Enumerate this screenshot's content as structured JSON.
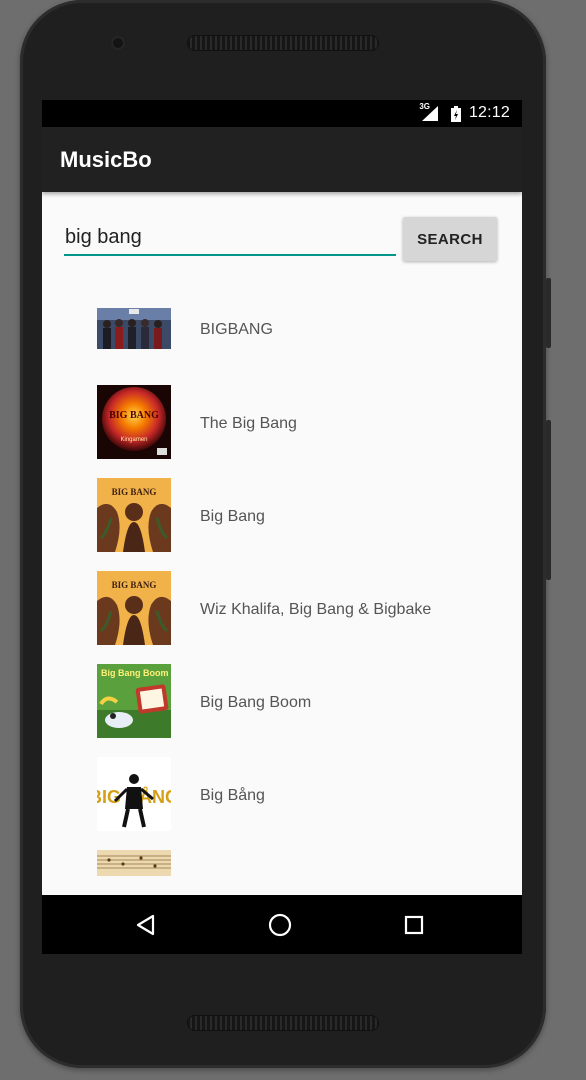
{
  "status_bar": {
    "network": "3G",
    "time": "12:12"
  },
  "app": {
    "title": "MusicBo"
  },
  "search": {
    "value": "big bang",
    "button_label": "SEARCH"
  },
  "results": [
    {
      "title": "BIGBANG",
      "thumbnail": "group-photo"
    },
    {
      "title": "The Big Bang",
      "thumbnail": "red-glow-cover",
      "cover_text": "BIG BANG",
      "cover_subtext": "Kingamen"
    },
    {
      "title": "Big Bang",
      "thumbnail": "orange-brown-cover",
      "cover_text": "BIG BANG"
    },
    {
      "title": "Wiz Khalifa, Big Bang & Bigbake",
      "thumbnail": "orange-brown-cover",
      "cover_text": "BIG BANG"
    },
    {
      "title": "Big Bang Boom",
      "thumbnail": "green-cartoon-cover",
      "cover_text": "Big Bang Boom"
    },
    {
      "title": "Big Bång",
      "thumbnail": "white-figure-cover",
      "cover_text": "BIG BÅNG"
    },
    {
      "title": "",
      "thumbnail": "sheet-music-cover"
    }
  ],
  "navigation": {
    "back": "back-icon",
    "home": "home-icon",
    "recents": "recents-icon"
  },
  "colors": {
    "accent": "#009688",
    "appbar": "#212121",
    "background": "#fafafa"
  }
}
